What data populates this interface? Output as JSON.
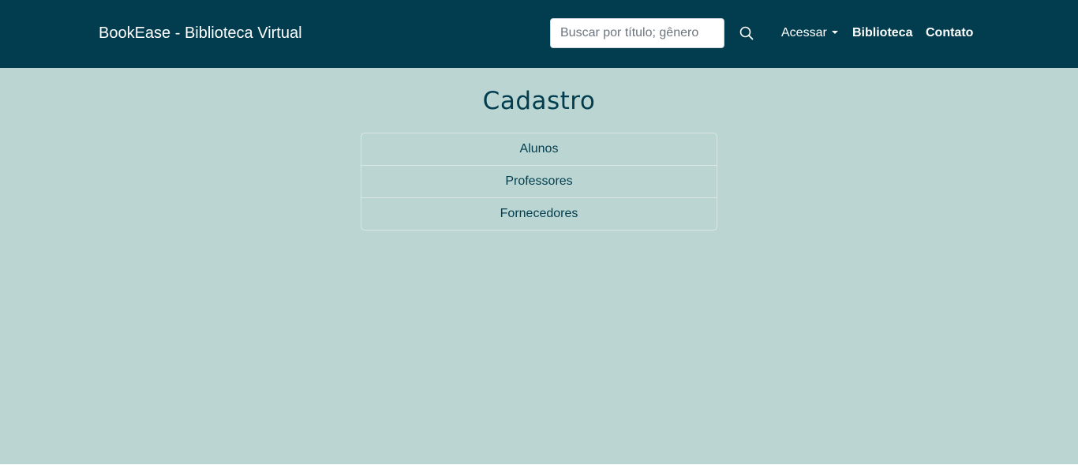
{
  "navbar": {
    "brand": "BookEase - Biblioteca Virtual",
    "search": {
      "placeholder": "Buscar por título; gênero",
      "value": "",
      "icon": "search-icon"
    },
    "links": {
      "acessar": "Acessar",
      "biblioteca": "Biblioteca",
      "contato": "Contato"
    },
    "colors": {
      "background": "#023d4f",
      "text": "#ffffff"
    }
  },
  "main": {
    "title": "Cadastro",
    "items": [
      {
        "label": "Alunos"
      },
      {
        "label": "Professores"
      },
      {
        "label": "Fornecedores"
      }
    ],
    "colors": {
      "background": "#bbd6d2",
      "text": "#023d4f"
    }
  }
}
